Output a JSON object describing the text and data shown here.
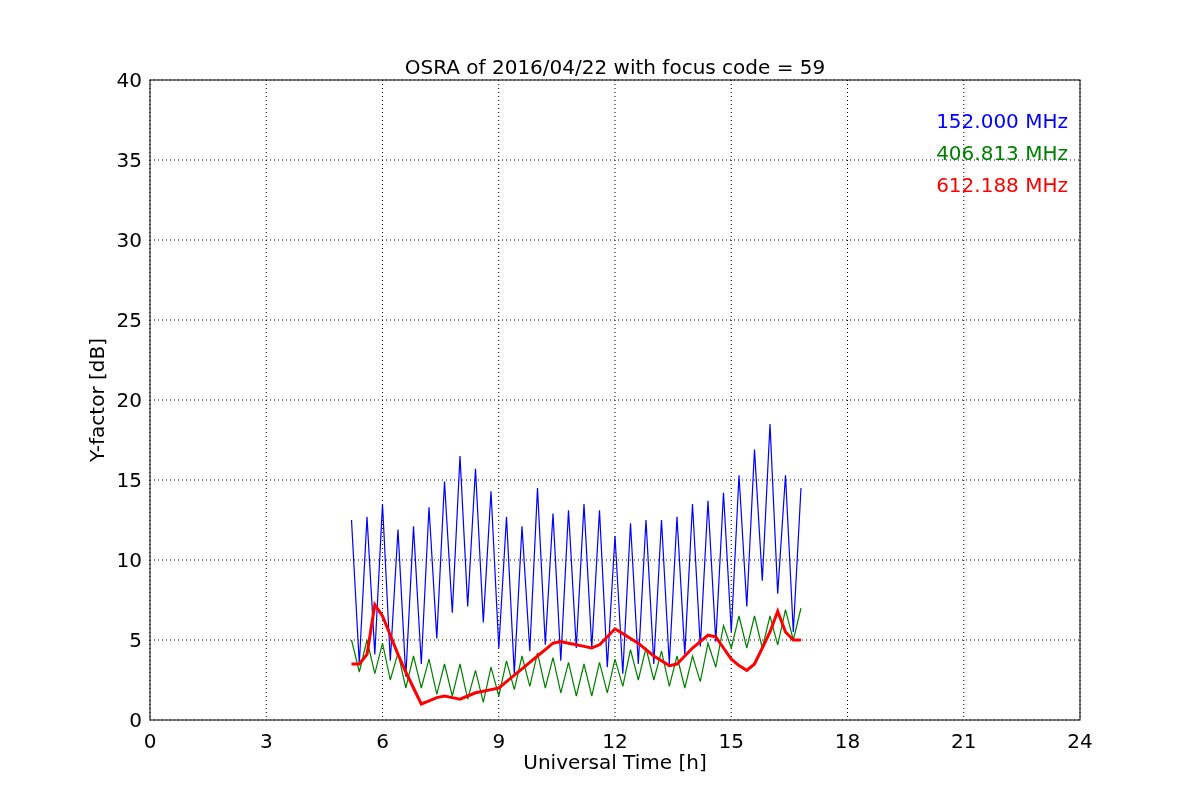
{
  "chart_data": {
    "type": "line",
    "title": "OSRA of 2016/04/22 with focus code = 59",
    "xlabel": "Universal Time [h]",
    "ylabel": "Y-factor [dB]",
    "xlim": [
      0,
      24
    ],
    "ylim": [
      0,
      40
    ],
    "xticks": [
      0,
      3,
      6,
      9,
      12,
      15,
      18,
      21,
      24
    ],
    "yticks": [
      0,
      5,
      10,
      15,
      20,
      25,
      30,
      35,
      40
    ],
    "grid": true,
    "x": [
      5.2,
      5.4,
      5.6,
      5.8,
      6.0,
      6.2,
      6.4,
      6.6,
      6.8,
      7.0,
      7.2,
      7.4,
      7.6,
      7.8,
      8.0,
      8.2,
      8.4,
      8.6,
      8.8,
      9.0,
      9.2,
      9.4,
      9.6,
      9.8,
      10.0,
      10.2,
      10.4,
      10.6,
      10.8,
      11.0,
      11.2,
      11.4,
      11.6,
      11.8,
      12.0,
      12.2,
      12.4,
      12.6,
      12.8,
      13.0,
      13.2,
      13.4,
      13.6,
      13.8,
      14.0,
      14.2,
      14.4,
      14.6,
      14.8,
      15.0,
      15.2,
      15.4,
      15.6,
      15.8,
      16.0,
      16.2,
      16.4,
      16.6,
      16.8
    ],
    "series": [
      {
        "name": "152.000 MHz",
        "color": "#0000ff",
        "values": [
          12.5,
          3.5,
          12.7,
          4.1,
          13.5,
          3.7,
          11.9,
          2.7,
          12.1,
          3.5,
          13.3,
          5.1,
          14.9,
          6.7,
          16.5,
          7.1,
          15.7,
          6.1,
          14.3,
          4.5,
          12.7,
          2.9,
          12.1,
          4.3,
          14.5,
          4.7,
          12.9,
          3.7,
          13.1,
          4.5,
          13.5,
          4.5,
          13.1,
          3.3,
          11.5,
          2.9,
          12.3,
          3.5,
          12.5,
          3.5,
          12.5,
          3.5,
          12.7,
          4.1,
          13.5,
          4.6,
          13.7,
          4.9,
          14.2,
          5.5,
          15.3,
          7.1,
          16.9,
          8.7,
          18.5,
          7.9,
          15.3,
          5.5,
          14.5
        ]
      },
      {
        "name": "406.813 MHz",
        "color": "#008000",
        "values": [
          5,
          3,
          5,
          2.9,
          4.8,
          2.5,
          4.2,
          2,
          4,
          2,
          3.8,
          1.6,
          3.5,
          1.5,
          3.5,
          1.3,
          3.1,
          1.1,
          3.3,
          1.5,
          3.7,
          1.9,
          4,
          2.1,
          4.2,
          2,
          3.9,
          1.7,
          3.6,
          1.5,
          3.5,
          1.5,
          3.6,
          1.7,
          3.8,
          2.1,
          4.4,
          2.5,
          4.5,
          2.5,
          4.3,
          2.1,
          4,
          2,
          4,
          2.4,
          4.8,
          3.3,
          5.9,
          4.5,
          6.5,
          4.5,
          6.5,
          4.5,
          6.5,
          4.7,
          6.9,
          5,
          7
        ]
      },
      {
        "name": "612.188 MHz",
        "color": "#ff0000",
        "values": [
          3.5,
          3.5,
          4.1,
          7.2,
          6.5,
          5.3,
          4.1,
          3,
          2,
          1,
          1.2,
          1.4,
          1.5,
          1.4,
          1.3,
          1.5,
          1.7,
          1.8,
          1.9,
          2,
          2.4,
          2.8,
          3.2,
          3.6,
          4,
          4.4,
          4.8,
          4.9,
          4.8,
          4.7,
          4.6,
          4.5,
          4.7,
          5.2,
          5.7,
          5.4,
          5.1,
          4.8,
          4.4,
          4,
          3.7,
          3.4,
          3.5,
          4,
          4.5,
          4.9,
          5.3,
          5.2,
          4.5,
          3.8,
          3.4,
          3.1,
          3.5,
          4.5,
          5.5,
          6.8,
          5.5,
          5,
          5
        ]
      }
    ]
  }
}
